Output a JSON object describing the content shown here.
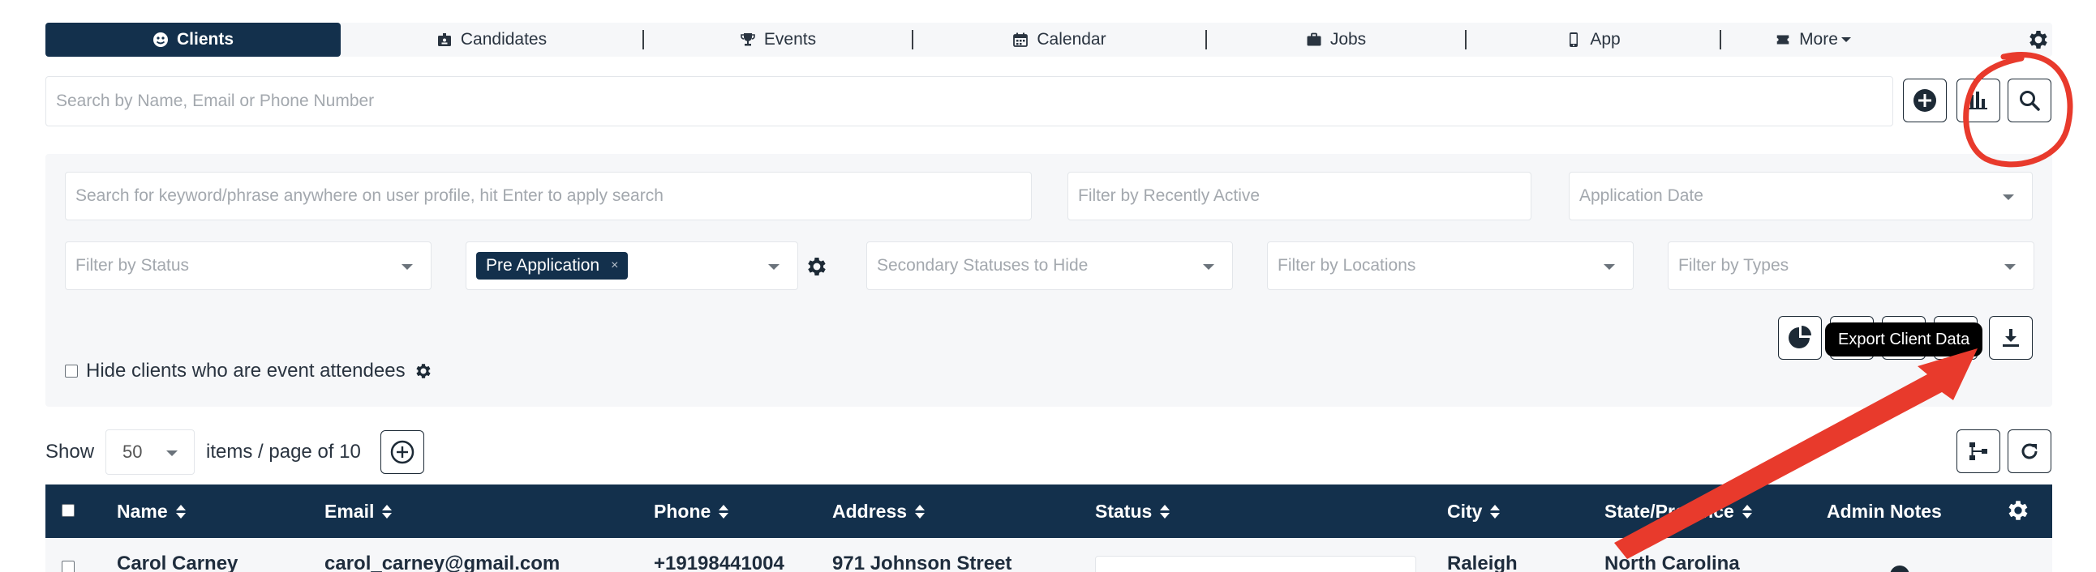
{
  "nav": {
    "tabs": [
      {
        "label": "Clients",
        "icon": "user-circle-icon",
        "active": true
      },
      {
        "label": "Candidates",
        "icon": "id-badge-icon"
      },
      {
        "label": "Events",
        "icon": "trophy-icon"
      },
      {
        "label": "Calendar",
        "icon": "calendar-icon"
      },
      {
        "label": "Jobs",
        "icon": "briefcase-icon"
      },
      {
        "label": "App",
        "icon": "mobile-icon"
      },
      {
        "label": "More",
        "icon": "ticket-icon"
      }
    ]
  },
  "search": {
    "placeholder": "Search by Name, Email or Phone Number"
  },
  "filters": {
    "keyword_placeholder": "Search for keyword/phrase anywhere on user profile, hit Enter to apply search",
    "recently_active_placeholder": "Filter by Recently Active",
    "application_date_placeholder": "Application Date",
    "status_placeholder": "Filter by Status",
    "selected_status_tag": "Pre Application",
    "secondary_placeholder": "Secondary Statuses to Hide",
    "locations_placeholder": "Filter by Locations",
    "types_placeholder": "Filter by Types",
    "hide_attendees_label": "Hide clients who are event attendees",
    "tag_remove": "×"
  },
  "tooltip": {
    "export": "Export Client Data"
  },
  "pagination": {
    "show_label": "Show",
    "page_size": "50",
    "suffix": "items / page of 10"
  },
  "table": {
    "columns": [
      "Name",
      "Email",
      "Phone",
      "Address",
      "Status",
      "City",
      "State/Province",
      "Admin Notes"
    ],
    "first_row": {
      "name": "Carol Carney",
      "email": "carol_carney@gmail.com",
      "phone": "+19198441004",
      "address": "971 Johnson Street",
      "city": "Raleigh",
      "state": "North Carolina"
    }
  },
  "colors": {
    "navy": "#13304c",
    "panel": "#f6f7f9",
    "annotation_red": "#e83a2c"
  }
}
